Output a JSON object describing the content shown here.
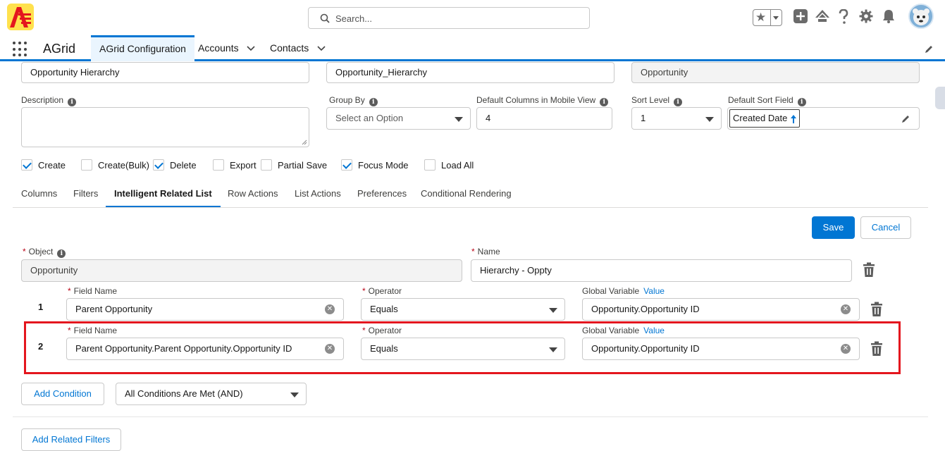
{
  "header": {
    "search_placeholder": "Search...",
    "icons": [
      "favorites-star-icon",
      "add-icon",
      "trailhead-icon",
      "help-icon",
      "setup-gear-icon",
      "notifications-bell-icon",
      "avatar"
    ]
  },
  "nav": {
    "app_name": "AGrid",
    "tabs": [
      {
        "label": "AGrid Configuration",
        "active": true
      },
      {
        "label": "Accounts",
        "active": false
      },
      {
        "label": "Contacts",
        "active": false
      }
    ]
  },
  "config": {
    "grid_label_value": "Opportunity Hierarchy",
    "grid_api_name_value": "Opportunity_Hierarchy",
    "object_value": "Opportunity",
    "description_label": "Description",
    "description_value": "",
    "group_by_label": "Group By",
    "group_by_placeholder": "Select an Option",
    "mobile_cols_label": "Default Columns in Mobile View",
    "mobile_cols_value": "4",
    "sort_level_label": "Sort Level",
    "sort_level_value": "1",
    "sort_field_label": "Default Sort Field",
    "sort_field_value": "Created Date",
    "checkboxes": [
      {
        "label": "Create",
        "checked": true
      },
      {
        "label": "Create(Bulk)",
        "checked": false
      },
      {
        "label": "Delete",
        "checked": true
      },
      {
        "label": "Export",
        "checked": false
      },
      {
        "label": "Partial Save",
        "checked": false
      },
      {
        "label": "Focus Mode",
        "checked": true
      },
      {
        "label": "Load All",
        "checked": false
      }
    ]
  },
  "tabs": [
    {
      "label": "Columns",
      "active": false
    },
    {
      "label": "Filters",
      "active": false
    },
    {
      "label": "Intelligent Related List",
      "active": true
    },
    {
      "label": "Row Actions",
      "active": false
    },
    {
      "label": "List Actions",
      "active": false
    },
    {
      "label": "Preferences",
      "active": false
    },
    {
      "label": "Conditional Rendering",
      "active": false
    }
  ],
  "related_list": {
    "save_label": "Save",
    "cancel_label": "Cancel",
    "object_label": "Object",
    "object_value": "Opportunity",
    "name_label": "Name",
    "name_value": "Hierarchy - Oppty",
    "field_name_label": "Field Name",
    "operator_label": "Operator",
    "global_variable_label": "Global Variable",
    "value_link": "Value",
    "conditions": [
      {
        "num": "1",
        "field": "Parent Opportunity",
        "operator": "Equals",
        "global_variable": "Opportunity.Opportunity ID"
      },
      {
        "num": "2",
        "field": "Parent Opportunity.Parent Opportunity.Opportunity ID",
        "operator": "Equals",
        "global_variable": "Opportunity.Opportunity ID"
      }
    ],
    "add_condition_label": "Add Condition",
    "logic_value": "All Conditions Are Met (AND)",
    "add_related_filters_label": "Add Related Filters"
  },
  "colors": {
    "brand": "#0176d3",
    "highlight": "#e4161e",
    "required": "#ba0517"
  }
}
